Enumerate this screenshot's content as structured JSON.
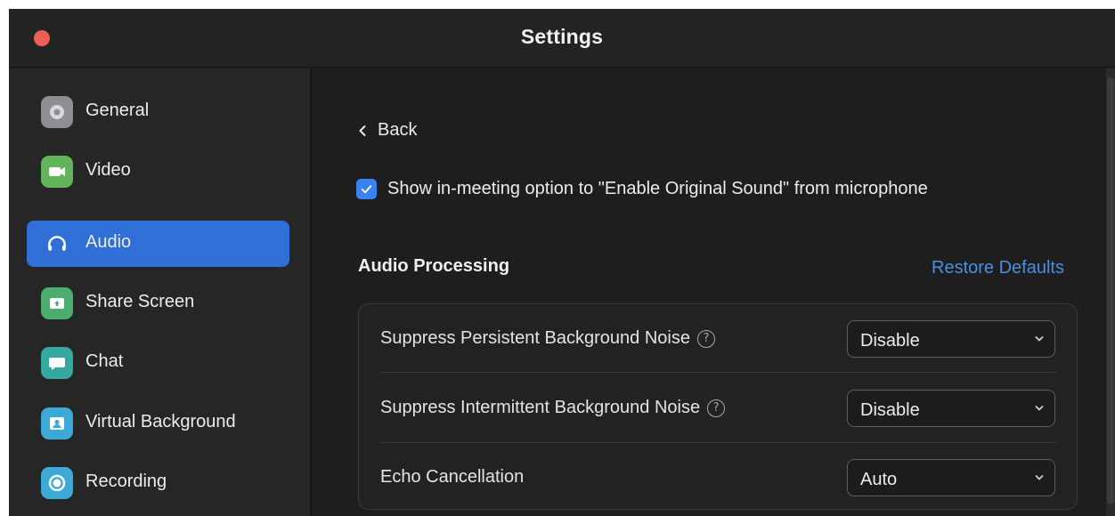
{
  "window": {
    "title": "Settings"
  },
  "colors": {
    "accent": "#2f6fd6",
    "link": "#4a90e2",
    "close_button": "#ec5f56"
  },
  "sidebar": {
    "items": [
      {
        "label": "General",
        "icon": "gear-icon",
        "icon_bg": "#8e8e93"
      },
      {
        "label": "Video",
        "icon": "video-camera-icon",
        "icon_bg": "#63b55a"
      },
      {
        "label": "Audio",
        "icon": "headphones-icon",
        "icon_bg": "transparent",
        "active": true
      },
      {
        "label": "Share Screen",
        "icon": "share-screen-icon",
        "icon_bg": "#4cae6e"
      },
      {
        "label": "Chat",
        "icon": "chat-bubble-icon",
        "icon_bg": "#35a8a0"
      },
      {
        "label": "Virtual Background",
        "icon": "person-portrait-icon",
        "icon_bg": "#3da9d6"
      },
      {
        "label": "Recording",
        "icon": "record-icon",
        "icon_bg": "#3da9d6"
      }
    ]
  },
  "main": {
    "back_label": "Back",
    "original_sound_checkbox": {
      "label": "Show in-meeting option to \"Enable Original Sound\" from microphone",
      "checked": true
    },
    "audio_processing": {
      "title": "Audio Processing",
      "restore_label": "Restore Defaults",
      "rows": [
        {
          "label": "Suppress Persistent Background Noise",
          "has_help": true,
          "value": "Disable"
        },
        {
          "label": "Suppress Intermittent Background Noise",
          "has_help": true,
          "value": "Disable"
        },
        {
          "label": "Echo Cancellation",
          "has_help": false,
          "value": "Auto"
        }
      ]
    }
  }
}
